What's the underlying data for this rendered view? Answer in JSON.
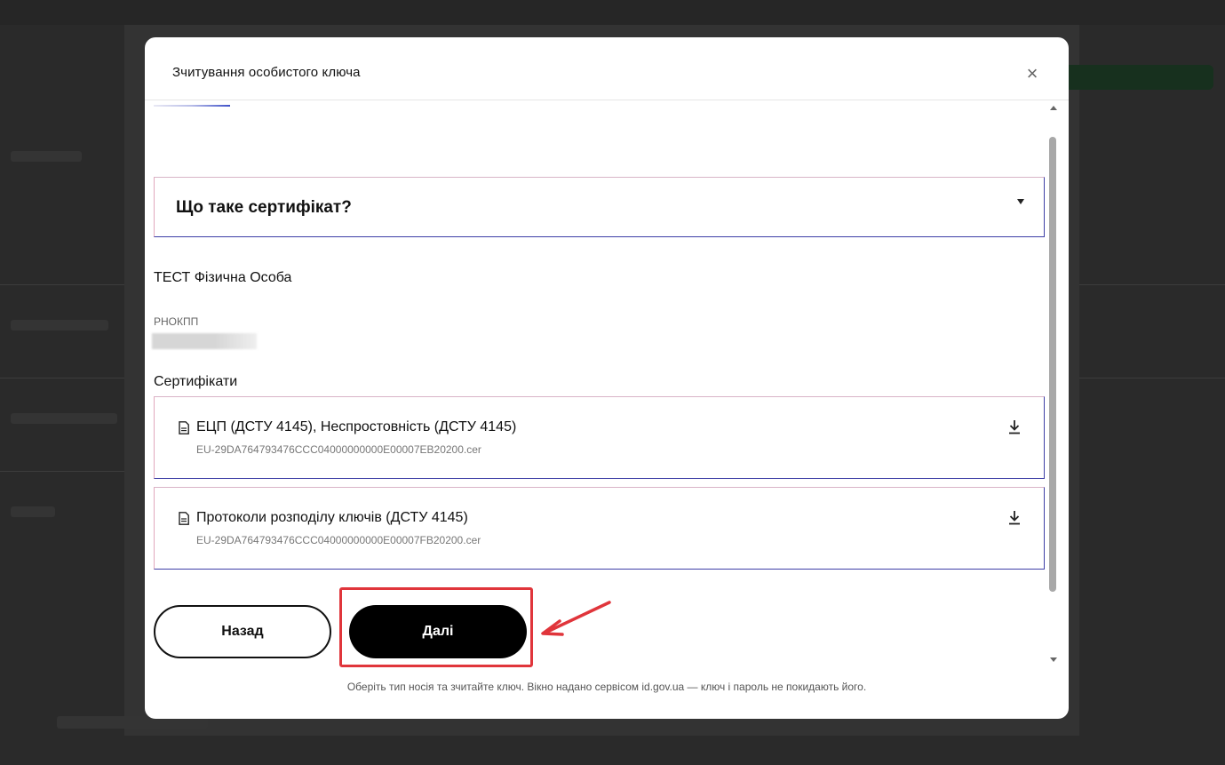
{
  "modal": {
    "title": "Зчитування особистого ключа",
    "close_symbol": "×",
    "accordion": {
      "title": "Що таке сертифікат?"
    },
    "person": {
      "name": "ТЕСТ Фізична Особа",
      "rnokpp_label": "РНОКПП"
    },
    "certificates": {
      "heading": "Сертифікати",
      "items": [
        {
          "title": "ЕЦП (ДСТУ 4145), Неспростовність (ДСТУ 4145)",
          "file": "EU-29DA764793476CCC04000000000E00007EB20200.cer",
          "icon": "document-icon"
        },
        {
          "title": "Протоколи розподілу ключів (ДСТУ 4145)",
          "file": "EU-29DA764793476CCC04000000000E00007FB20200.cer",
          "icon": "document-icon"
        }
      ]
    },
    "buttons": {
      "back": "Назад",
      "next": "Далі"
    },
    "footer": "Оберіть тип носія та зчитайте ключ. Вікно надано сервісом id.gov.ua — ключ і пароль не покидають його."
  },
  "colors": {
    "accent_border": "#3d3ea6",
    "highlight": "#e0353b",
    "primary_button": "#000000",
    "overlay": "#2a2a2a"
  }
}
